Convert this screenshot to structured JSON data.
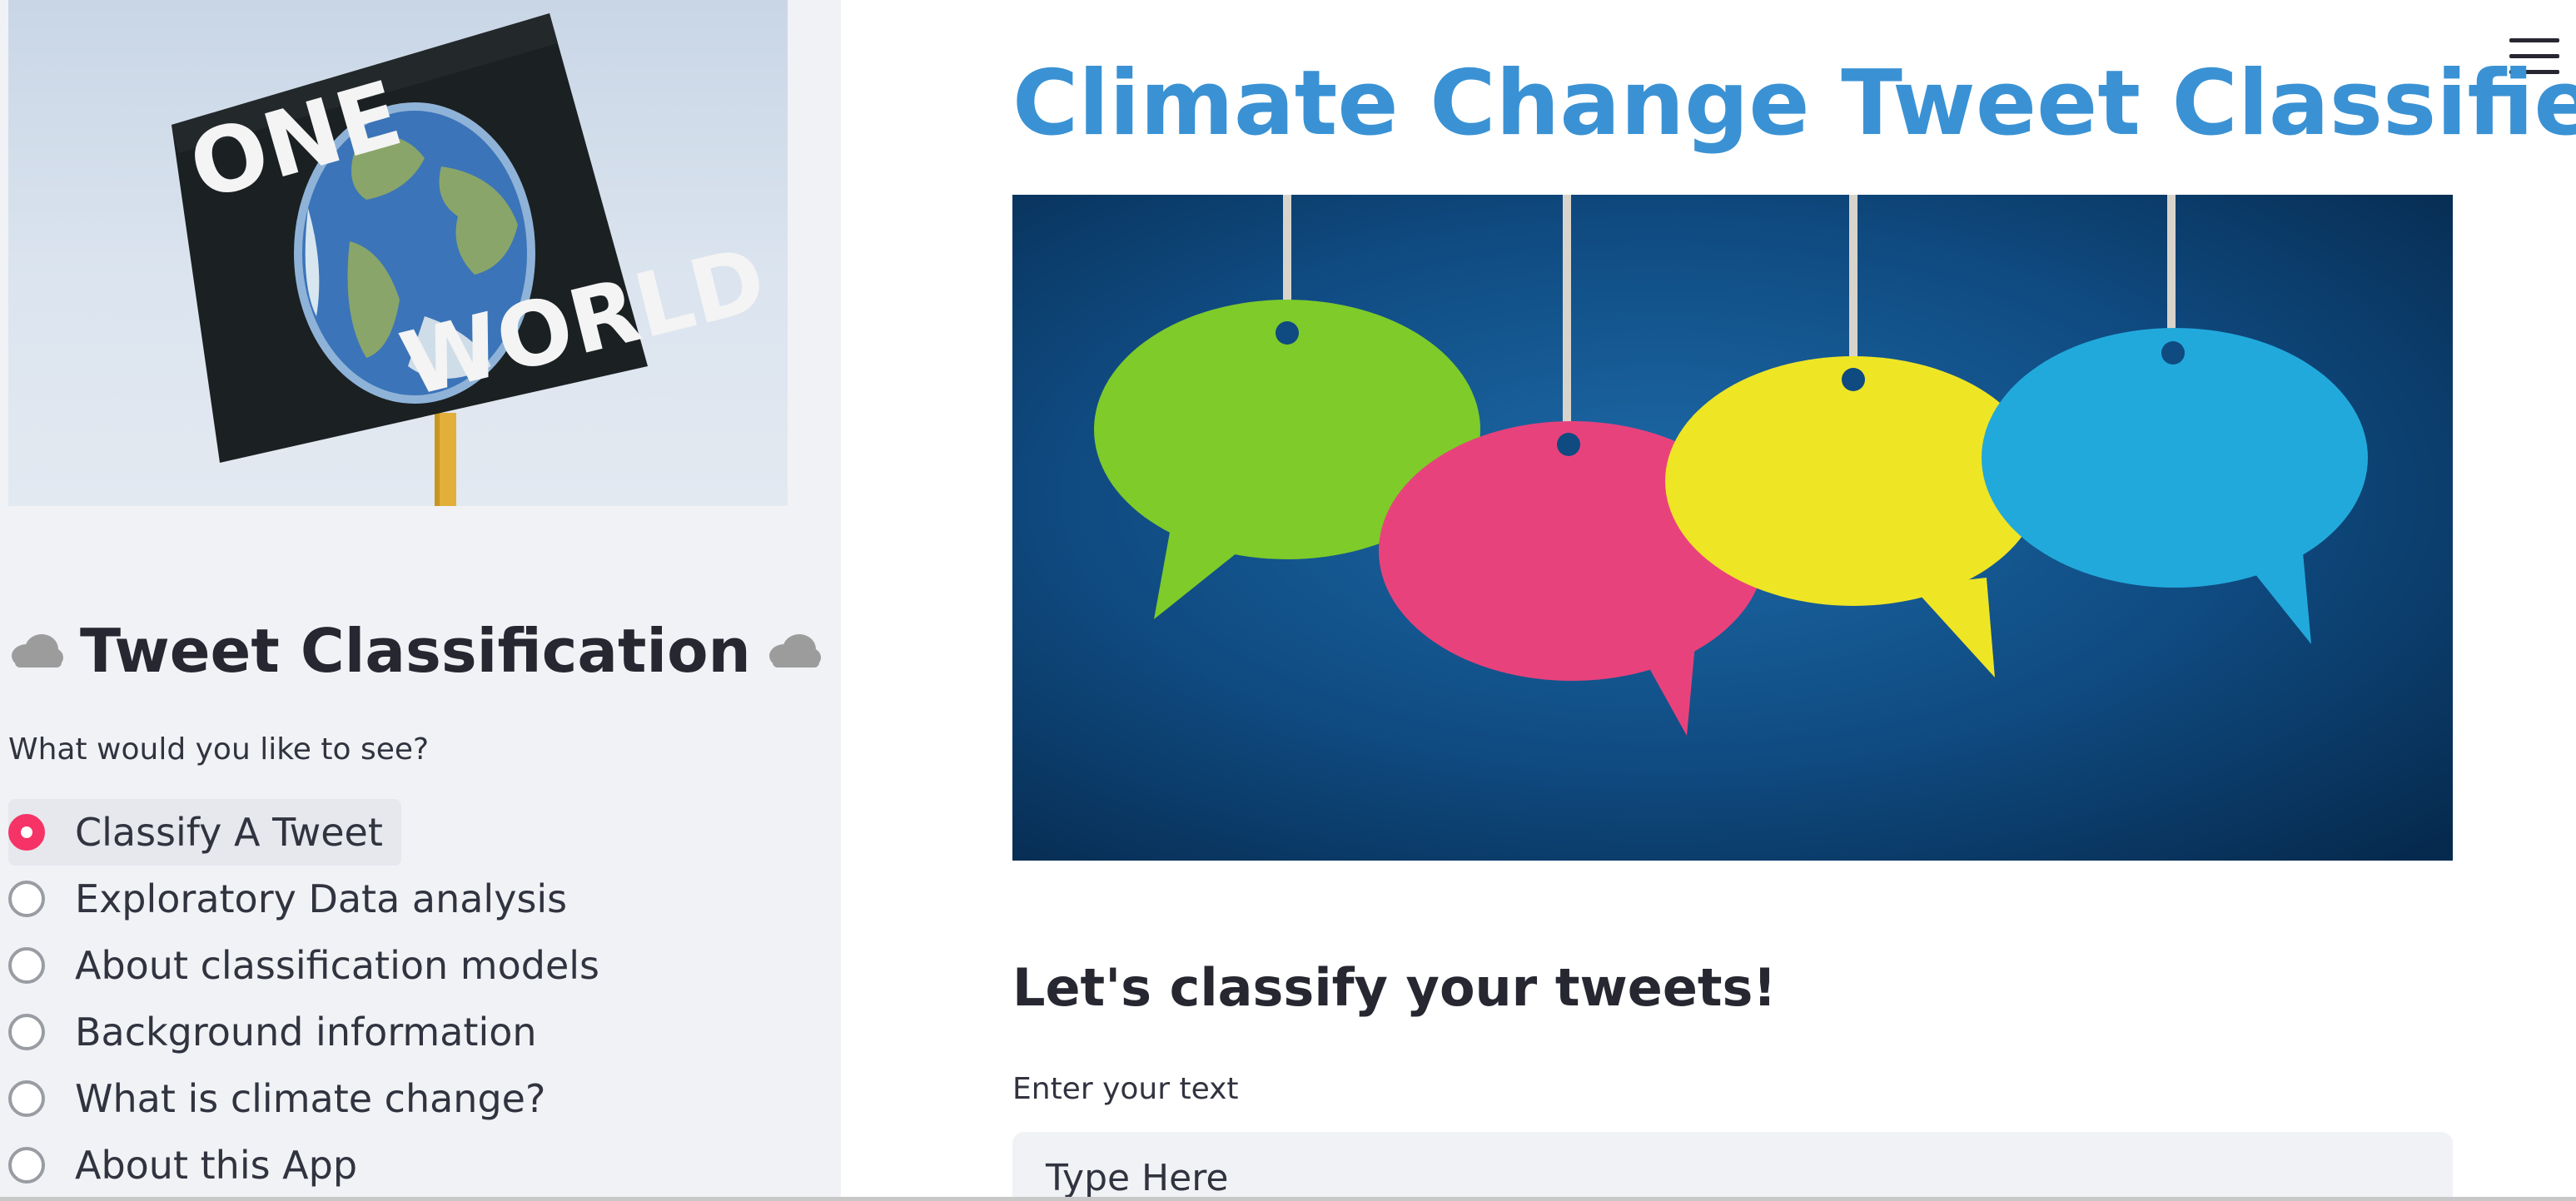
{
  "sidebar": {
    "banner_image": {
      "icon": "one-world-protest-sign",
      "sign_text_top": "ONE",
      "sign_text_bottom": "WORLD"
    },
    "title": "Tweet Classification",
    "title_icon": "cloud-icon",
    "prompt": "What would you like to see?",
    "options": [
      {
        "label": "Classify A Tweet",
        "selected": true
      },
      {
        "label": "Exploratory Data analysis",
        "selected": false
      },
      {
        "label": "About classification models",
        "selected": false
      },
      {
        "label": "Background information",
        "selected": false
      },
      {
        "label": "What is climate change?",
        "selected": false
      },
      {
        "label": "About this App",
        "selected": false
      }
    ]
  },
  "header": {
    "menu_icon": "hamburger-menu-icon"
  },
  "main": {
    "title": "Climate Change Tweet Classifier",
    "hero_image": {
      "icon": "speech-bubbles-image"
    },
    "section_heading": "Let's classify your tweets!",
    "input": {
      "label": "Enter your text",
      "value": "",
      "placeholder": "Type Here"
    }
  },
  "colors": {
    "title": "#3a92d4",
    "accent": "#f63366",
    "sidebar_bg": "#f0f2f6",
    "input_bg": "#f0f2f6",
    "hero_bg": "#0d4a7f",
    "bubble_green": "#7ecb2a",
    "bubble_pink": "#e8427c",
    "bubble_yellow": "#eee525",
    "bubble_blue": "#22a9dc"
  }
}
